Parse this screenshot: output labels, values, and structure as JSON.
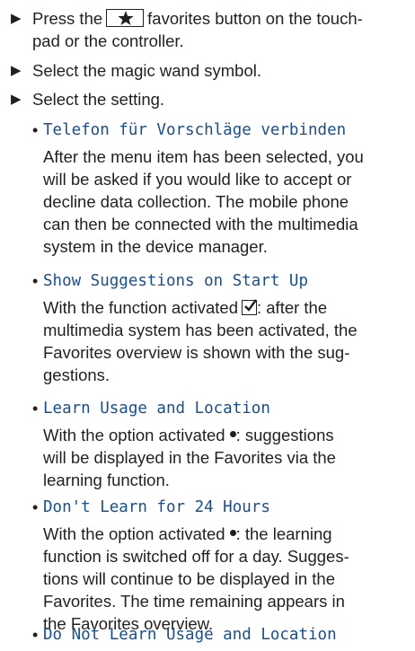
{
  "steps": [
    {
      "before": "Press the",
      "icon": "star-icon",
      "after_line1": "favorites button on the touch-",
      "line2": "pad or the controller."
    },
    {
      "text": "Select the magic wand symbol."
    },
    {
      "text": "Select the setting."
    }
  ],
  "options": [
    {
      "title": "Telefon für Vorschläge verbinden",
      "lines": [
        "After the menu item has been selected, you",
        "will be asked if you would like to accept or",
        "decline data collection. The mobile phone",
        "can then be connected with the multimedia",
        "system in the device manager."
      ]
    },
    {
      "title": "Show Suggestions on Start Up",
      "pre": "With the function activated",
      "indicator": "checkbox-checked-icon",
      "post": ": after the",
      "lines": [
        "multimedia system has been activated, the",
        "Favorites overview is shown with the sug-",
        "gestions."
      ]
    },
    {
      "title": "Learn Usage and Location",
      "pre": "With the option activated",
      "indicator": "radio-dot-icon",
      "post": ": suggestions",
      "lines": [
        "will be displayed in the Favorites via the",
        "learning function."
      ]
    },
    {
      "title": "Don't Learn for 24 Hours",
      "pre": "With the option activated",
      "indicator": "radio-dot-icon",
      "post": ": the learning",
      "lines": [
        "function is switched off for a day. Sugges-",
        "tions will continue to be displayed in the",
        "Favorites. The time remaining appears in",
        "the Favorites overview."
      ]
    },
    {
      "title": "Do Not Learn Usage and Location"
    }
  ],
  "glyphs": {
    "arrow": "▶",
    "bullet": "•"
  },
  "colors": {
    "text": "#231f20",
    "menu_item": "#1b4f8a"
  }
}
